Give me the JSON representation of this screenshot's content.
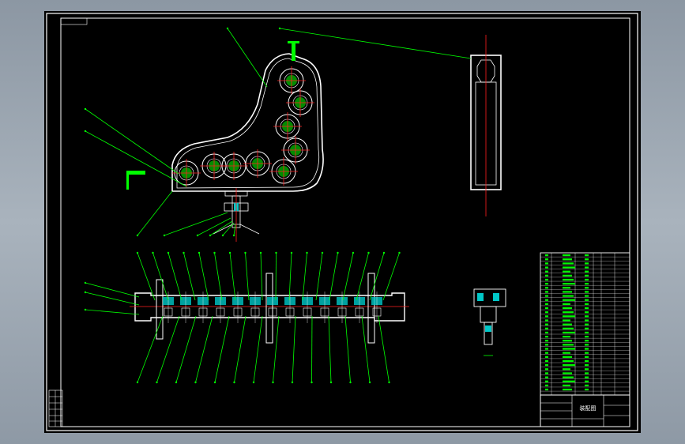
{
  "colors": {
    "background": "#000000",
    "outline": "#ffffff",
    "leader": "#00ff00",
    "centerline": "#ff2020",
    "section_fill": "#00c8c8",
    "hatch": "#00ff00"
  },
  "title_block": {
    "drawing_name": "装配图"
  }
}
